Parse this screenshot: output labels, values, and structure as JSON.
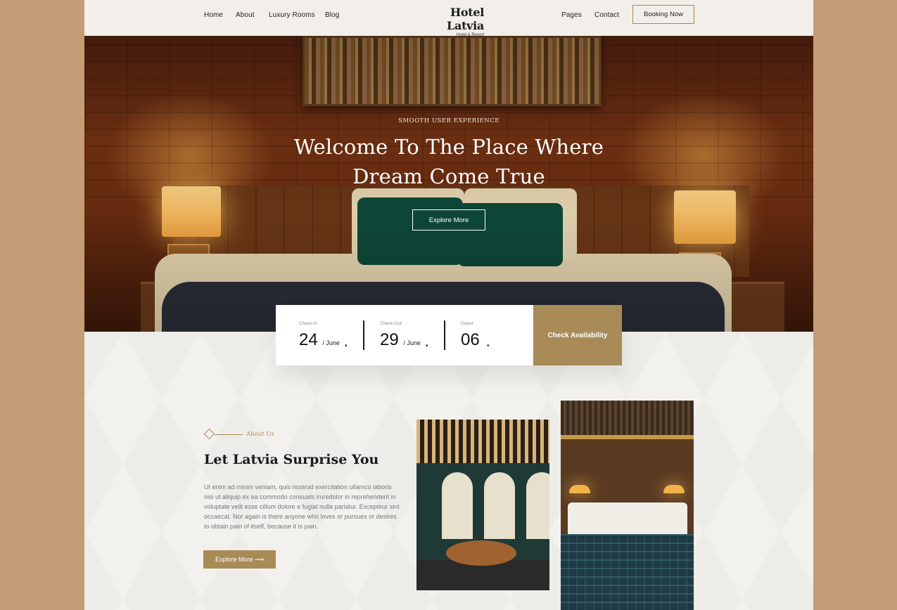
{
  "nav": {
    "links": [
      "Home",
      "About",
      "Luxury Rooms",
      "Blog"
    ],
    "links_right": [
      "Pages",
      "Contact"
    ],
    "brand_name": "Hotel Latvia",
    "brand_sub": "Hotel & Resort",
    "booking_button": "Booking Now"
  },
  "hero": {
    "eyebrow": "SMOOTH USER EXPERIENCE",
    "title_line1": "Welcome To The Place Where",
    "title_line2": "Dream Come True",
    "button": "Explore More"
  },
  "booking": {
    "checkin": {
      "label": "Check-In",
      "day": "24",
      "month": "/ June"
    },
    "checkout": {
      "label": "Check-Out",
      "day": "29",
      "month": "/ June"
    },
    "guest": {
      "label": "Guest",
      "value": "06"
    },
    "button": "Check Availability",
    "caret": "▾"
  },
  "about": {
    "eyebrow": "About Us",
    "title": "Let Latvia Surprise You",
    "body": "Ut enim ad minim veniam, quis nostrud exercitation ullamco laboris nisi ut aliquip ex ea commodo consuats  iruredolor in reprehenderit in voluptate velit esse cillum dolore e fugiat nulla pariatur. Excepteur sint occaecat. Nor again is there anyone who loves or pursues or desires to obtain pain of itself, because it is pain.",
    "button": "Explore More",
    "button_arrow": "⟶"
  },
  "colors": {
    "accent": "#a98b58",
    "backdrop": "#c49c75",
    "page": "#f3f0eb"
  }
}
